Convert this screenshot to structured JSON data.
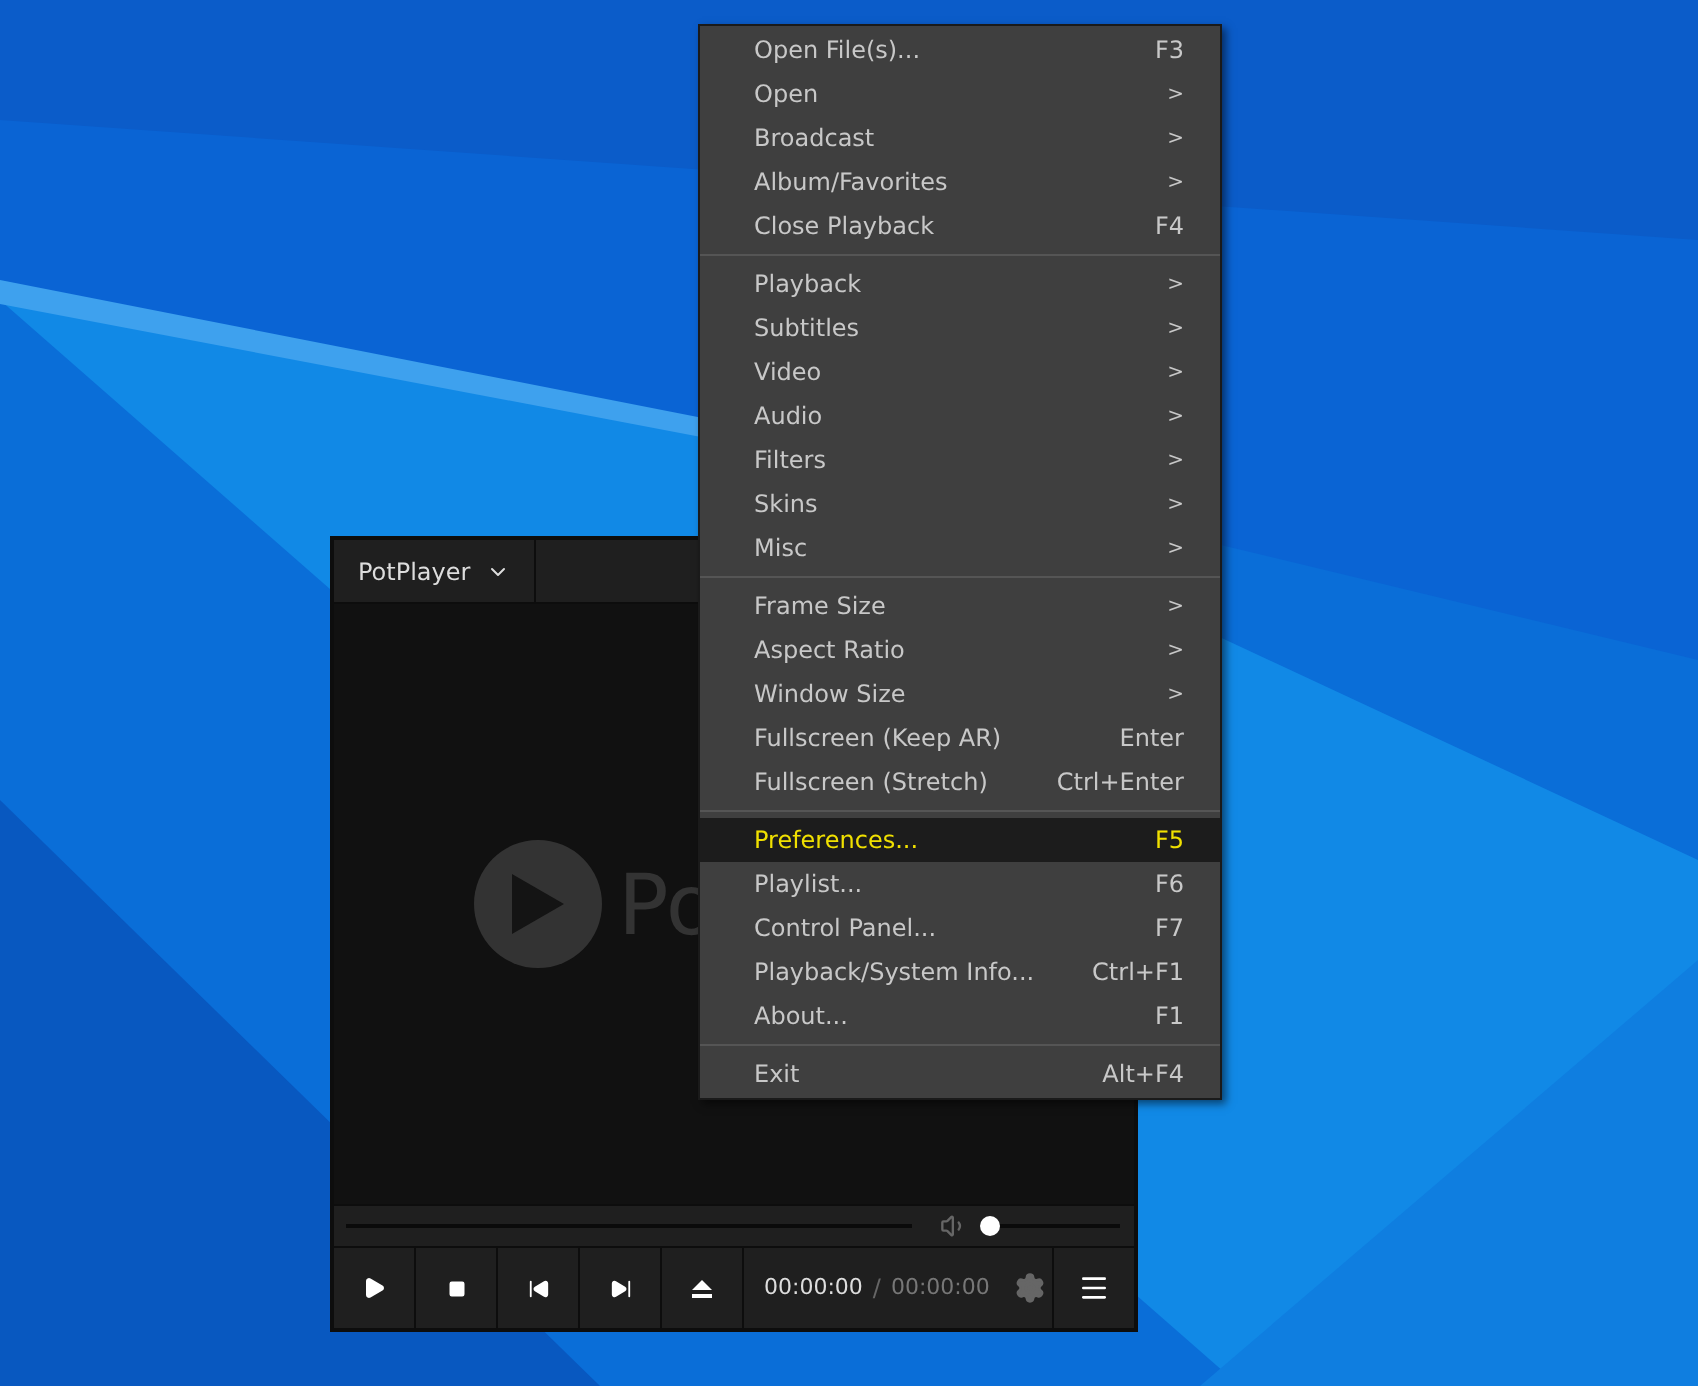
{
  "player": {
    "title": "PotPlayer",
    "logo_text": "Po",
    "volume": {
      "level": 0.07
    },
    "time_current": "00:00:00",
    "time_separator": "/",
    "time_total": "00:00:00"
  },
  "context_menu": {
    "sections": [
      [
        {
          "label": "Open File(s)...",
          "shortcut": "F3",
          "selected": false
        },
        {
          "label": "Open",
          "shortcut": ">",
          "selected": false
        },
        {
          "label": "Broadcast",
          "shortcut": ">",
          "selected": false
        },
        {
          "label": "Album/Favorites",
          "shortcut": ">",
          "selected": false
        },
        {
          "label": "Close Playback",
          "shortcut": "F4",
          "selected": false
        }
      ],
      [
        {
          "label": "Playback",
          "shortcut": ">",
          "selected": false
        },
        {
          "label": "Subtitles",
          "shortcut": ">",
          "selected": false
        },
        {
          "label": "Video",
          "shortcut": ">",
          "selected": false
        },
        {
          "label": "Audio",
          "shortcut": ">",
          "selected": false
        },
        {
          "label": "Filters",
          "shortcut": ">",
          "selected": false
        },
        {
          "label": "Skins",
          "shortcut": ">",
          "selected": false
        },
        {
          "label": "Misc",
          "shortcut": ">",
          "selected": false
        }
      ],
      [
        {
          "label": "Frame Size",
          "shortcut": ">",
          "selected": false
        },
        {
          "label": "Aspect Ratio",
          "shortcut": ">",
          "selected": false
        },
        {
          "label": "Window Size",
          "shortcut": ">",
          "selected": false
        },
        {
          "label": "Fullscreen (Keep AR)",
          "shortcut": "Enter",
          "selected": false
        },
        {
          "label": "Fullscreen (Stretch)",
          "shortcut": "Ctrl+Enter",
          "selected": false
        }
      ],
      [
        {
          "label": "Preferences...",
          "shortcut": "F5",
          "selected": true
        },
        {
          "label": "Playlist...",
          "shortcut": "F6",
          "selected": false
        },
        {
          "label": "Control Panel...",
          "shortcut": "F7",
          "selected": false
        },
        {
          "label": "Playback/System Info...",
          "shortcut": "Ctrl+F1",
          "selected": false
        },
        {
          "label": "About...",
          "shortcut": "F1",
          "selected": false
        }
      ],
      [
        {
          "label": "Exit",
          "shortcut": "Alt+F4",
          "selected": false
        }
      ]
    ]
  }
}
